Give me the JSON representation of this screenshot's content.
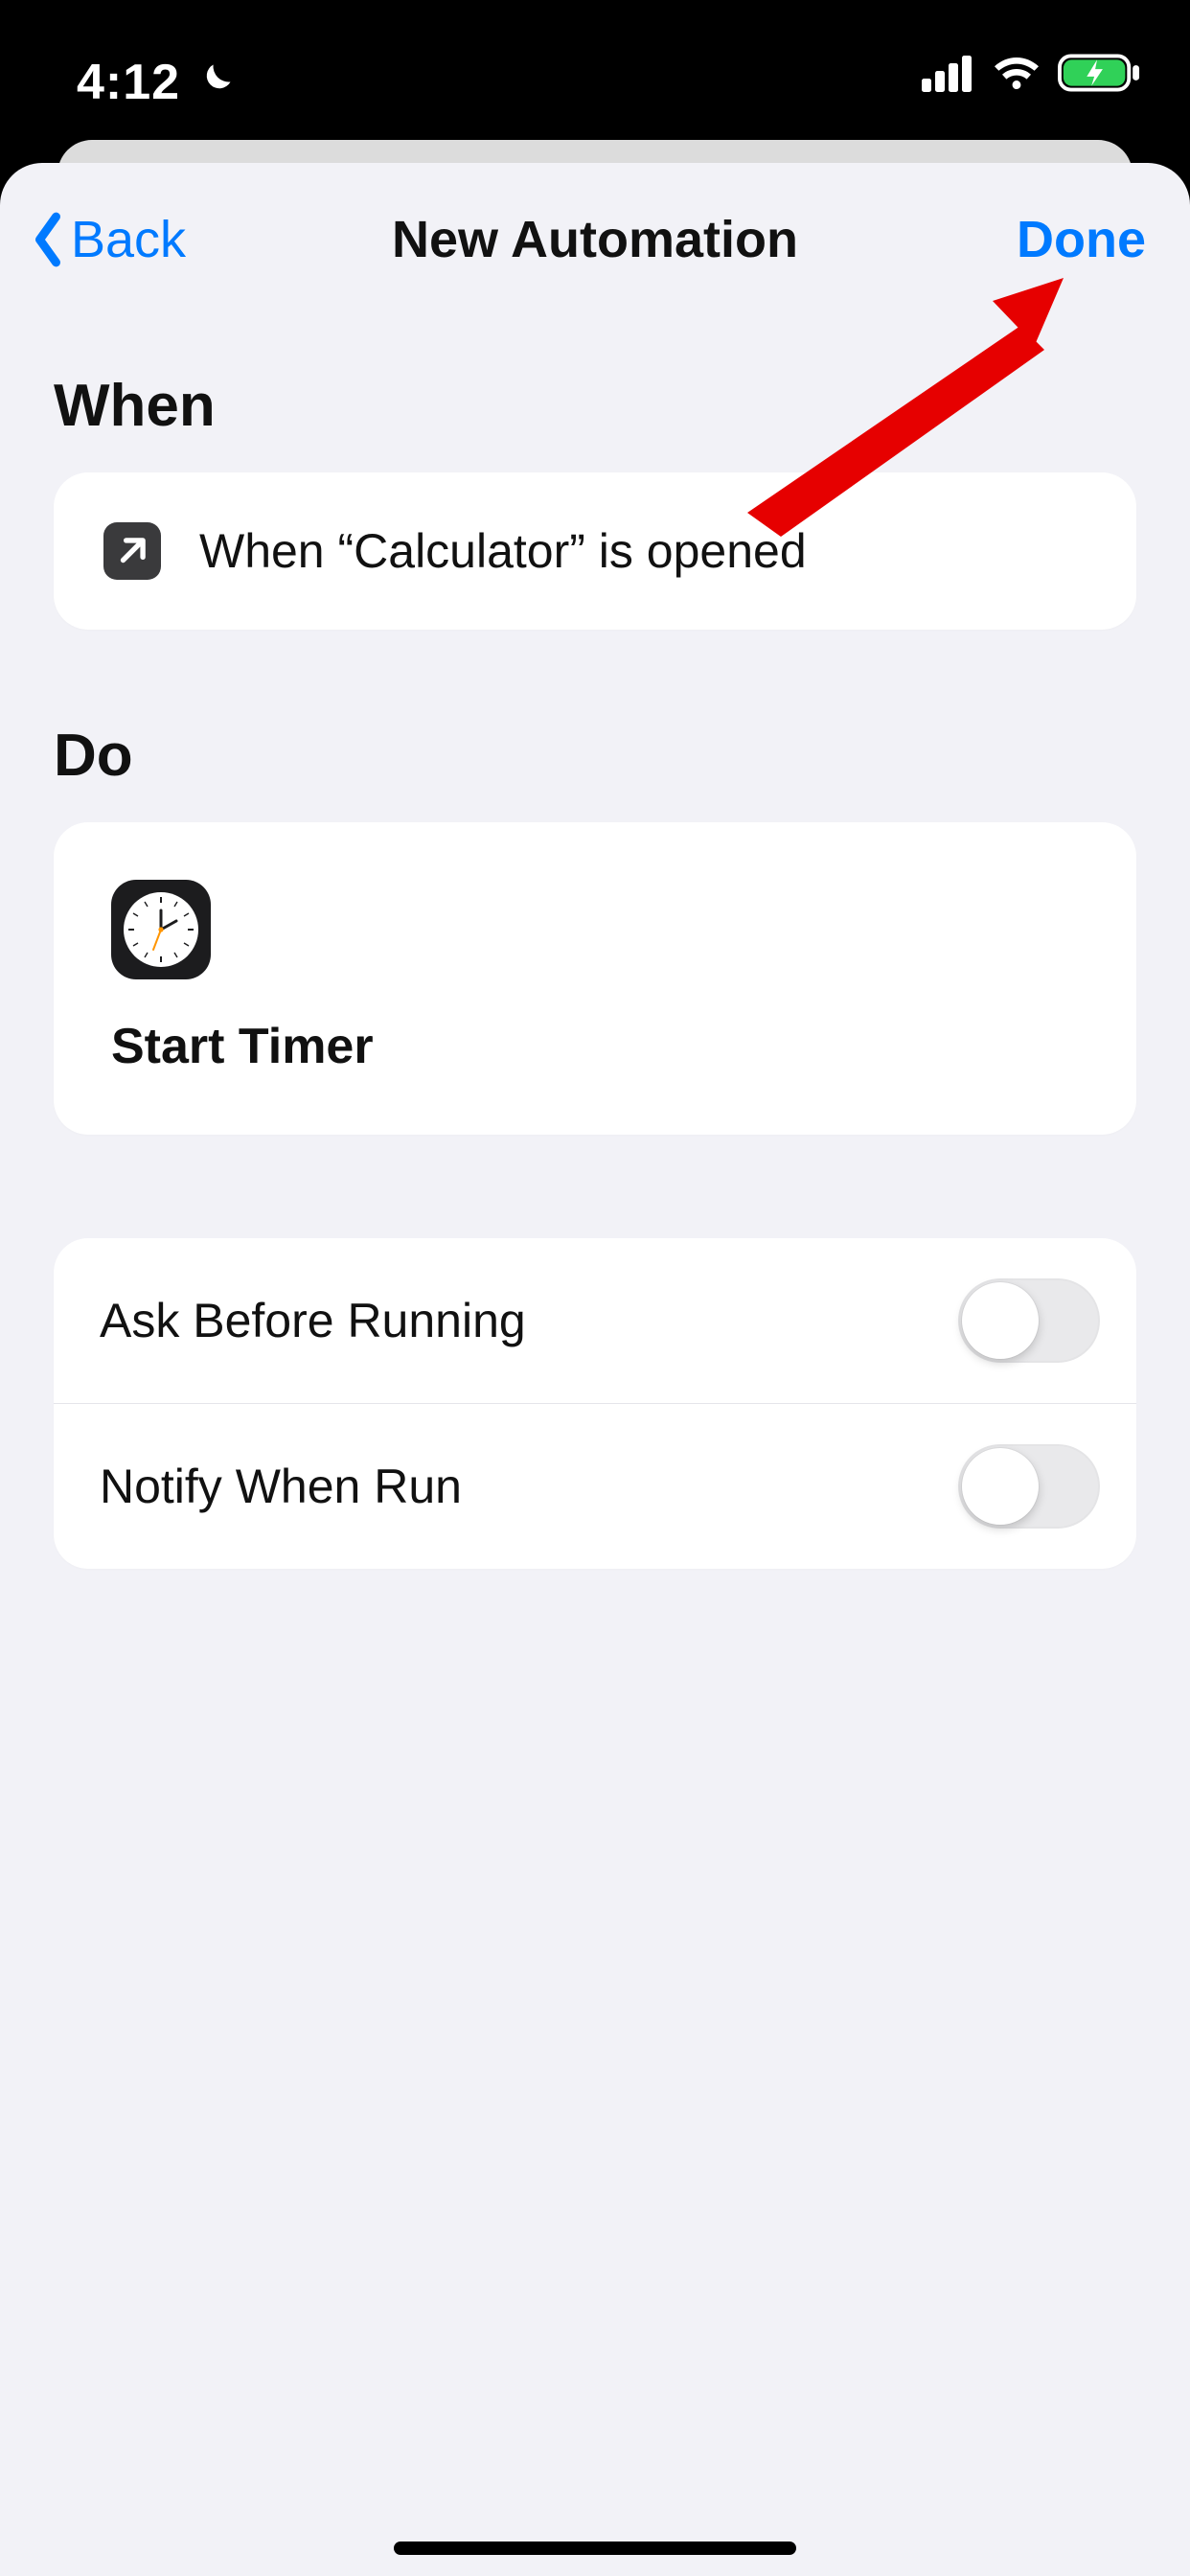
{
  "statusbar": {
    "time": "4:12"
  },
  "nav": {
    "back": "Back",
    "title": "New Automation",
    "done": "Done"
  },
  "sections": {
    "when": {
      "title": "When",
      "condition": "When “Calculator” is opened",
      "icon": "open-app-icon"
    },
    "do": {
      "title": "Do",
      "action": "Start Timer",
      "icon": "clock-app-icon"
    }
  },
  "settings": {
    "ask_before_running": {
      "label": "Ask Before Running",
      "on": false
    },
    "notify_when_run": {
      "label": "Notify When Run",
      "on": false
    }
  }
}
